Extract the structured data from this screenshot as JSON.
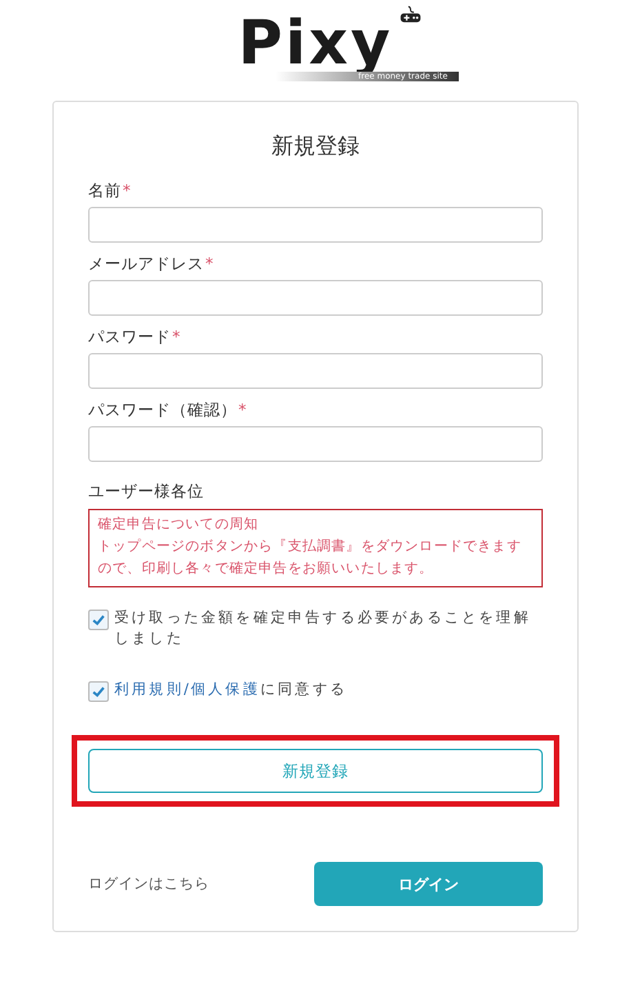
{
  "logo": {
    "name": "Pixy",
    "tagline": "free money trade site"
  },
  "form": {
    "title": "新規登録",
    "fields": [
      {
        "label": "名前",
        "required_mark": "*"
      },
      {
        "label": "メールアドレス",
        "required_mark": "*"
      },
      {
        "label": "パスワード",
        "required_mark": "*"
      },
      {
        "label": "パスワード（確認）",
        "required_mark": "*"
      }
    ],
    "notice_heading": "ユーザー様各位",
    "notice": {
      "title": "確定申告についての周知",
      "body": "トップページのボタンから『支払調書』をダウンロードできますので、印刷し各々で確定申告をお願いいたします。"
    },
    "agreements": [
      {
        "kind": "plain",
        "text": "受け取った金額を確定申告する必要があることを理解しました",
        "checked": true
      },
      {
        "kind": "link",
        "link": "利用規則/個人保護",
        "text": "に同意する",
        "checked": true
      }
    ],
    "register_button": {
      "label": "新規登録",
      "highlighted": true
    },
    "login_prompt": "ログインはこちら",
    "login_button": "ログイン"
  }
}
